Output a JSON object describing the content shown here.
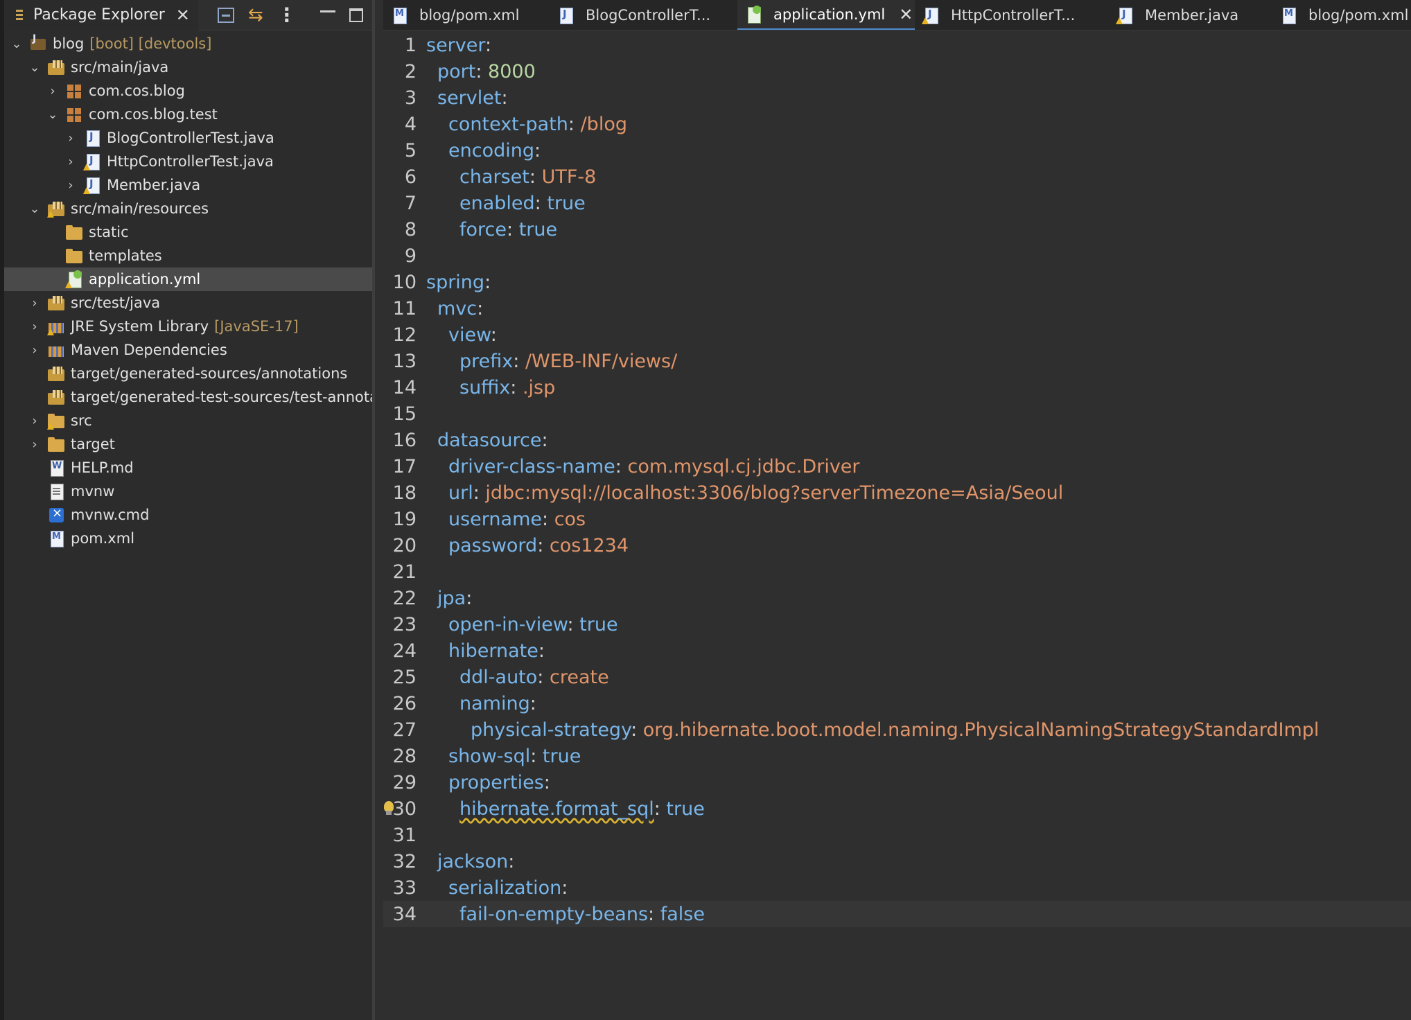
{
  "explorer": {
    "title": "Package Explorer",
    "rows": [
      {
        "label": "blog",
        "decor": "[boot] [devtools]"
      },
      {
        "label": "src/main/java"
      },
      {
        "label": "com.cos.blog"
      },
      {
        "label": "com.cos.blog.test"
      },
      {
        "label": "BlogControllerTest.java"
      },
      {
        "label": "HttpControllerTest.java"
      },
      {
        "label": "Member.java"
      },
      {
        "label": "src/main/resources"
      },
      {
        "label": "static"
      },
      {
        "label": "templates"
      },
      {
        "label": "application.yml"
      },
      {
        "label": "src/test/java"
      },
      {
        "label": "JRE System Library",
        "decor": "[JavaSE-17]"
      },
      {
        "label": "Maven Dependencies"
      },
      {
        "label": "target/generated-sources/annotations"
      },
      {
        "label": "target/generated-test-sources/test-annotations"
      },
      {
        "label": "src"
      },
      {
        "label": "target"
      },
      {
        "label": "HELP.md"
      },
      {
        "label": "mvnw"
      },
      {
        "label": "mvnw.cmd"
      },
      {
        "label": "pom.xml"
      }
    ]
  },
  "editor_tabs": [
    {
      "label": "blog/pom.xml"
    },
    {
      "label": "BlogControllerT..."
    },
    {
      "label": "application.yml"
    },
    {
      "label": "HttpControllerT..."
    },
    {
      "label": "Member.java"
    },
    {
      "label": "blog/pom.xml"
    }
  ],
  "code": [
    {
      "n": "1",
      "key": "server",
      "sep": ":",
      "val": ""
    },
    {
      "n": "2",
      "key": "port",
      "sep": ": ",
      "val": "8000"
    },
    {
      "n": "3",
      "key": "servlet",
      "sep": ":",
      "val": ""
    },
    {
      "n": "4",
      "key": "context-path",
      "sep": ": ",
      "val": "/blog"
    },
    {
      "n": "5",
      "key": "encoding",
      "sep": ":",
      "val": ""
    },
    {
      "n": "6",
      "key": "charset",
      "sep": ": ",
      "val": "UTF-8"
    },
    {
      "n": "7",
      "key": "enabled",
      "sep": ": ",
      "val": "true"
    },
    {
      "n": "8",
      "key": "force",
      "sep": ": ",
      "val": "true"
    },
    {
      "n": "9",
      "key": "",
      "sep": "",
      "val": ""
    },
    {
      "n": "10",
      "key": "spring",
      "sep": ":",
      "val": ""
    },
    {
      "n": "11",
      "key": "mvc",
      "sep": ":",
      "val": ""
    },
    {
      "n": "12",
      "key": "view",
      "sep": ":",
      "val": ""
    },
    {
      "n": "13",
      "key": "prefix",
      "sep": ": ",
      "val": "/WEB-INF/views/"
    },
    {
      "n": "14",
      "key": "suffix",
      "sep": ": ",
      "val": ".jsp"
    },
    {
      "n": "15",
      "key": "",
      "sep": "",
      "val": ""
    },
    {
      "n": "16",
      "key": "datasource",
      "sep": ":",
      "val": ""
    },
    {
      "n": "17",
      "key": "driver-class-name",
      "sep": ": ",
      "val": "com.mysql.cj.jdbc.Driver"
    },
    {
      "n": "18",
      "key": "url",
      "sep": ": ",
      "val": "jdbc:mysql://localhost:3306/blog?serverTimezone=Asia/Seoul"
    },
    {
      "n": "19",
      "key": "username",
      "sep": ": ",
      "val": "cos"
    },
    {
      "n": "20",
      "key": "password",
      "sep": ": ",
      "val": "cos1234"
    },
    {
      "n": "21",
      "key": "",
      "sep": "",
      "val": ""
    },
    {
      "n": "22",
      "key": "jpa",
      "sep": ":",
      "val": ""
    },
    {
      "n": "23",
      "key": "open-in-view",
      "sep": ": ",
      "val": "true"
    },
    {
      "n": "24",
      "key": "hibernate",
      "sep": ":",
      "val": ""
    },
    {
      "n": "25",
      "key": "ddl-auto",
      "sep": ": ",
      "val": "create"
    },
    {
      "n": "26",
      "key": "naming",
      "sep": ":",
      "val": ""
    },
    {
      "n": "27",
      "key": "physical-strategy",
      "sep": ": ",
      "val": "org.hibernate.boot.model.naming.PhysicalNamingStrategyStandardImpl"
    },
    {
      "n": "28",
      "key": "show-sql",
      "sep": ": ",
      "val": "true"
    },
    {
      "n": "29",
      "key": "properties",
      "sep": ":",
      "val": ""
    },
    {
      "n": "30",
      "key": "hibernate.format_sql",
      "sep": ": ",
      "val": "true"
    },
    {
      "n": "31",
      "key": "",
      "sep": "",
      "val": ""
    },
    {
      "n": "32",
      "key": "jackson",
      "sep": ":",
      "val": ""
    },
    {
      "n": "33",
      "key": "serialization",
      "sep": ":",
      "val": ""
    },
    {
      "n": "34",
      "key": "fail-on-empty-beans",
      "sep": ": ",
      "val": "false"
    }
  ]
}
